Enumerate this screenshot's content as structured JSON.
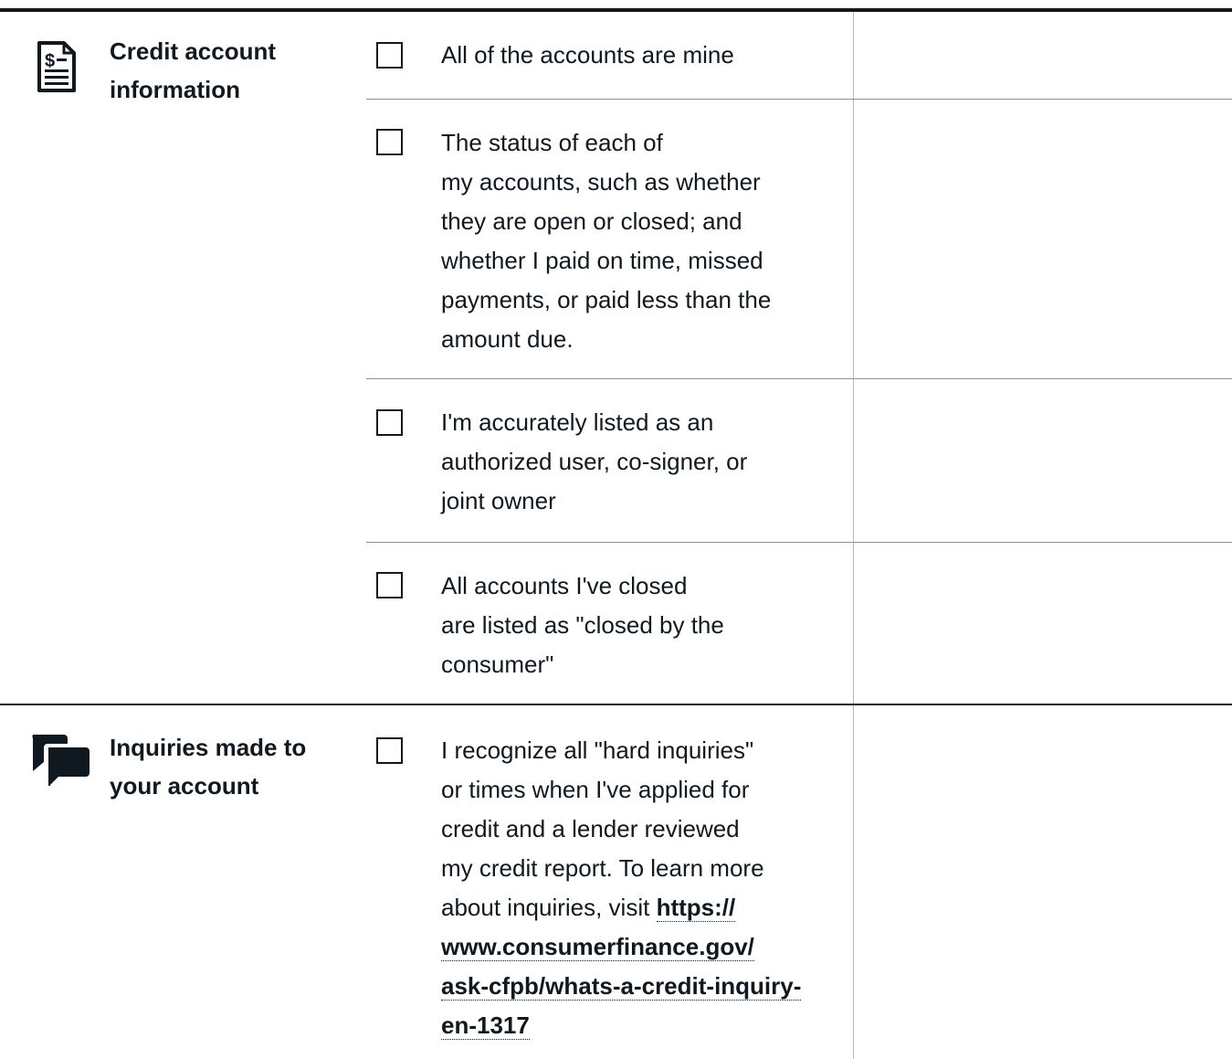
{
  "sections": [
    {
      "icon": "credit-report-document-icon",
      "title": "Credit account information",
      "items": [
        {
          "text": "All of the accounts are mine",
          "checked": false
        },
        {
          "text_lines": [
            "The status of each of",
            "my accounts, such as whether",
            "they are open or closed; and",
            "whether I paid on time, missed",
            "payments, or paid less than the",
            "amount due."
          ],
          "checked": false
        },
        {
          "text_lines": [
            "I'm accurately listed as an",
            "authorized user, co-signer, or",
            "joint owner"
          ],
          "checked": false
        },
        {
          "text_lines": [
            "All accounts I've closed",
            "are listed as \"closed by the",
            "consumer\""
          ],
          "checked": false
        }
      ]
    },
    {
      "icon": "chat-bubbles-icon",
      "title": "Inquiries made to your account",
      "items": [
        {
          "text_lines": [
            "I recognize all \"hard inquiries\"",
            "or times when I've applied for",
            "credit and a lender reviewed",
            "my credit report. To learn more",
            "about inquiries, visit "
          ],
          "link": {
            "lines": [
              "https://",
              "www.consumerfinance.gov/",
              "ask-cfpb/whats-a-credit-inquiry-",
              "en-1317"
            ],
            "href": "https://www.consumerfinance.gov/ask-cfpb/whats-a-credit-inquiry-en-1317"
          },
          "checked": false
        }
      ]
    }
  ]
}
